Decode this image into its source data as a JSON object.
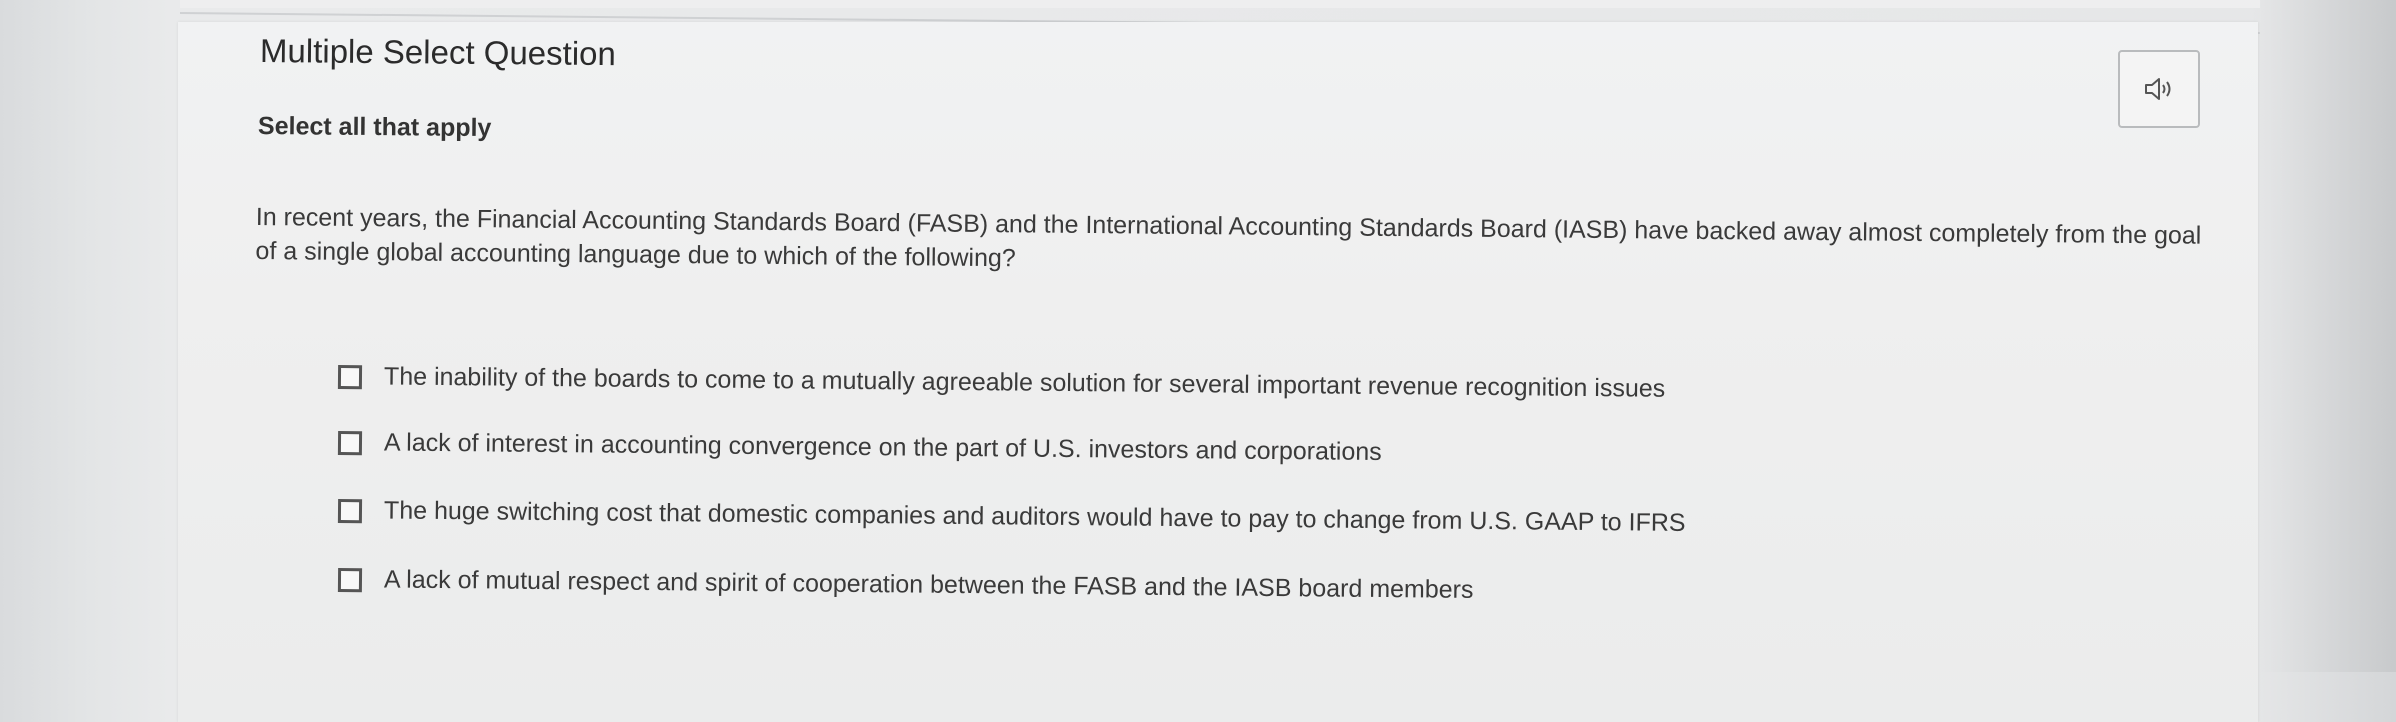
{
  "question": {
    "type_label": "Multiple Select Question",
    "instruction": "Select all that apply",
    "prompt": "In recent years, the Financial Accounting Standards Board (FASB) and the International Accounting Standards Board (IASB) have backed away almost completely from the goal of a single global accounting language due to which of the following?"
  },
  "audio_button": {
    "icon": "speaker-icon"
  },
  "options": [
    {
      "label": "The inability of the boards to come to a mutually agreeable solution for several important revenue recognition issues",
      "checked": false
    },
    {
      "label": "A lack of interest in accounting convergence on the part of U.S. investors and corporations",
      "checked": false
    },
    {
      "label": "The huge switching cost that domestic companies and auditors would have to pay to change from U.S. GAAP to IFRS",
      "checked": false
    },
    {
      "label": "A lack of mutual respect and spirit of cooperation between the FASB and the IASB board members",
      "checked": false
    }
  ]
}
